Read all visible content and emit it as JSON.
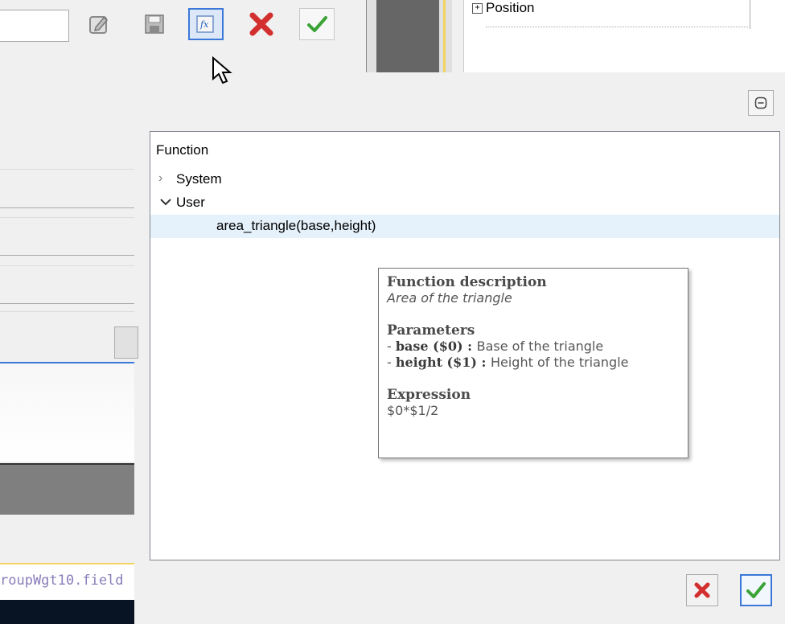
{
  "right_panel": {
    "position_label": "Position",
    "expand_glyph": "+"
  },
  "toolbar": {
    "buttons": [
      "edit-icon",
      "save-icon",
      "function-icon",
      "cancel-icon",
      "confirm-icon"
    ]
  },
  "function_panel": {
    "header": "Function",
    "tree": {
      "system_label": "System",
      "user_label": "User",
      "user_function": "area_triangle(base,height)"
    }
  },
  "tooltip": {
    "title": "Function description",
    "description": "Area of the triangle",
    "params_heading": "Parameters",
    "params": [
      {
        "dash": "- ",
        "name": "base ($0)",
        "sep": " : ",
        "desc": "Base of the triangle"
      },
      {
        "dash": "- ",
        "name": "height ($1)",
        "sep": " : ",
        "desc": "Height of the triangle"
      }
    ],
    "expr_heading": "Expression",
    "expression": "$0*$1/2"
  },
  "left_form": {
    "field_reference": "roupWgt10.field"
  },
  "colors": {
    "accent": "#3b78d8",
    "cancel_red": "#d32f2f",
    "ok_green": "#3aa335",
    "selection": "#e5f1fb"
  }
}
